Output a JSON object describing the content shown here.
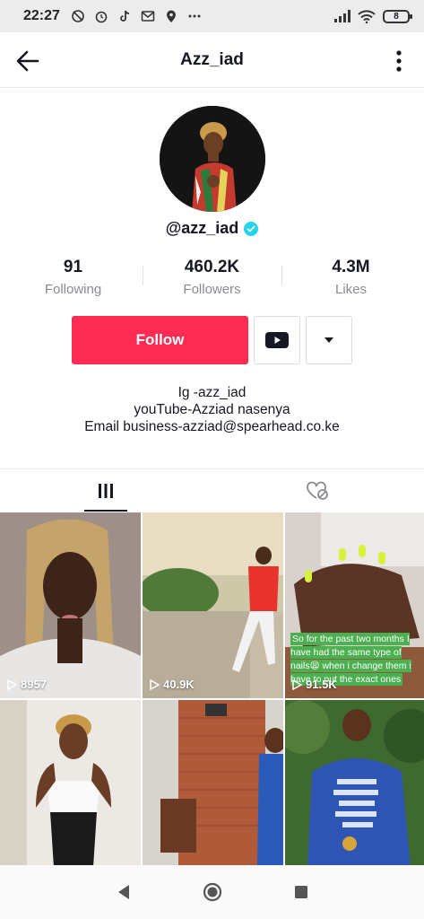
{
  "status_bar": {
    "time": "22:27",
    "battery": "8"
  },
  "header": {
    "title": "Azz_iad"
  },
  "profile": {
    "username": "@azz_iad",
    "stats": [
      {
        "value": "91",
        "label": "Following"
      },
      {
        "value": "460.2K",
        "label": "Followers"
      },
      {
        "value": "4.3M",
        "label": "Likes"
      }
    ],
    "follow_label": "Follow",
    "bio": [
      "Ig -azz_iad",
      "youTube-Azziad nasenya",
      "Email business-azziad@spearhead.co.ke"
    ]
  },
  "videos": [
    {
      "views": "8957"
    },
    {
      "views": "40.9K"
    },
    {
      "views": "91.5K",
      "caption": "So for the past two months I have had the same type of nails😫 when i change them i have to put the exact ones"
    },
    {},
    {},
    {}
  ],
  "colors": {
    "accent": "#fe2c55",
    "verified": "#20d5ec"
  }
}
